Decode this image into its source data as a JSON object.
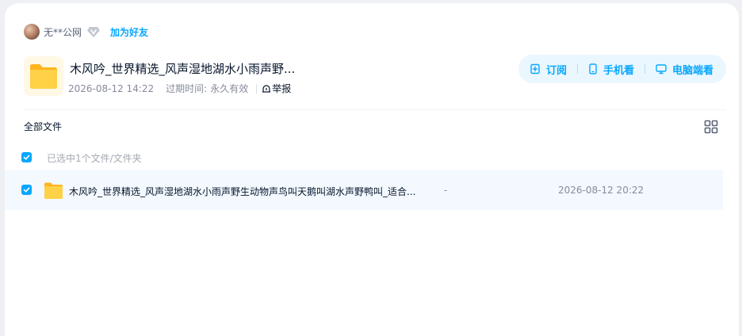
{
  "user": {
    "name": "无**公网",
    "add_friend_label": "加为好友"
  },
  "share": {
    "title": "木风吟_世界精选_风声湿地湖水小雨声野...",
    "created": "2026-08-12 14:22",
    "expire_label": "过期时间:",
    "expire_value": "永久有效",
    "report_label": "举报"
  },
  "actions": {
    "subscribe_label": "订阅",
    "mobile_label": "手机看",
    "pc_label": "电脑端看"
  },
  "breadcrumb": {
    "root_label": "全部文件"
  },
  "selection": {
    "summary": "已选中1个文件/文件夹"
  },
  "files": [
    {
      "name": "木风吟_世界精选_风声湿地湖水小雨声野生动物声鸟叫天鹅叫湖水声野鸭叫_适合...",
      "size": "-",
      "date": "2026-08-12 20:22",
      "selected": true
    }
  ],
  "colors": {
    "accent": "#06a7ff",
    "folder": "#ffc533",
    "row_selected_bg": "#f3f9ff"
  }
}
